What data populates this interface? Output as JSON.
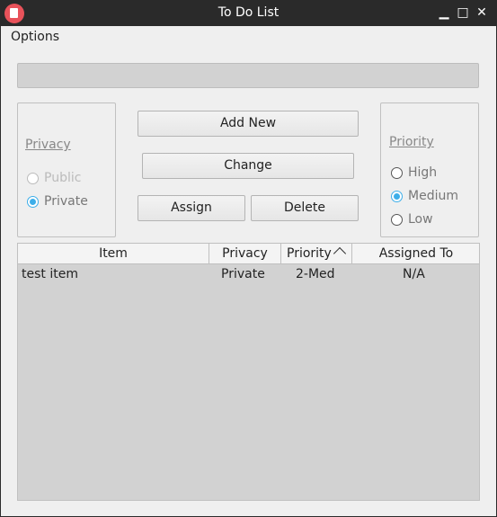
{
  "window": {
    "title": "To Do List",
    "controls": {
      "minimize": "▁",
      "maximize": "□",
      "close": "✕"
    }
  },
  "menu": {
    "options_label": "Options"
  },
  "progress": {
    "value": 0
  },
  "privacy_group": {
    "title": "Privacy",
    "options": [
      {
        "label": "Public",
        "checked": false,
        "enabled": false
      },
      {
        "label": "Private",
        "checked": true,
        "enabled": true
      }
    ]
  },
  "buttons": {
    "add_new": "Add New",
    "change": "Change",
    "assign": "Assign",
    "delete": "Delete"
  },
  "priority_group": {
    "title": "Priority",
    "options": [
      {
        "label": "High",
        "checked": false,
        "enabled": true
      },
      {
        "label": "Medium",
        "checked": true,
        "enabled": true
      },
      {
        "label": "Low",
        "checked": false,
        "enabled": true
      }
    ]
  },
  "table": {
    "headers": [
      "Item",
      "Privacy",
      "Priority",
      "Assigned To"
    ],
    "sort_indicator": "ascending",
    "rows": [
      {
        "item": "test item",
        "privacy": "Private",
        "priority": "2-Med",
        "assigned_to": "N/A"
      }
    ]
  },
  "colors": {
    "accent": "#3daee9",
    "titlebar": "#2a2a2a",
    "app_icon": "#e8525a"
  }
}
